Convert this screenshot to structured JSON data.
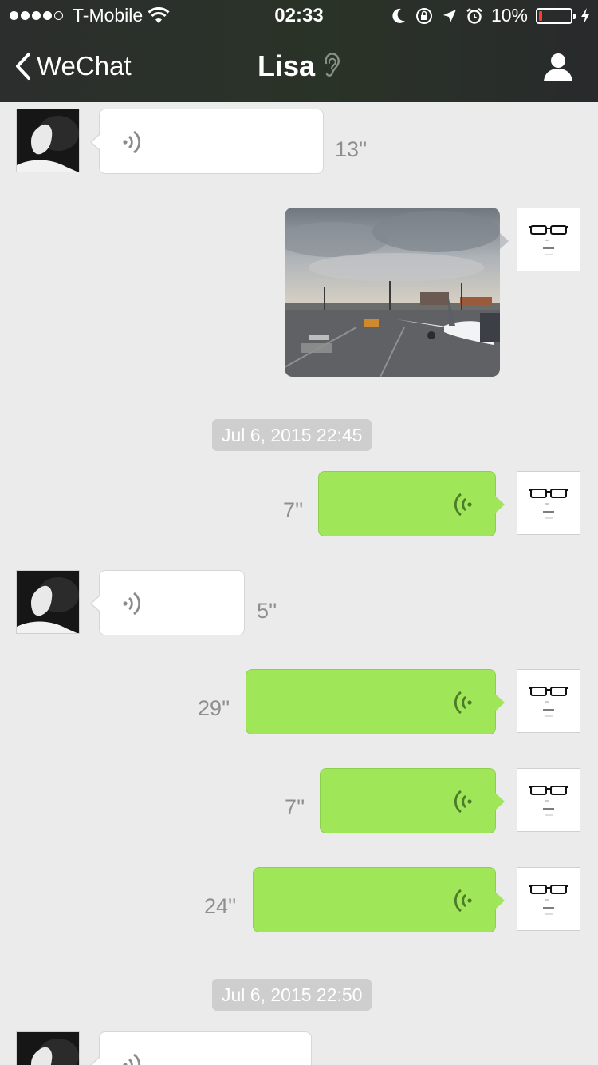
{
  "status": {
    "carrier": "T-Mobile",
    "time": "02:33",
    "battery": "10%",
    "battery_fraction": 0.1,
    "signal_bars": 4
  },
  "nav": {
    "back_label": "WeChat",
    "title": "Lisa"
  },
  "timestamps": [
    "Jul 6, 2015 22:45",
    "Jul 6, 2015 22:50"
  ],
  "messages": [
    {
      "side": "in",
      "type": "voice",
      "duration": "13''"
    },
    {
      "side": "out",
      "type": "image"
    },
    {
      "side": "out",
      "type": "voice",
      "duration": "7''"
    },
    {
      "side": "in",
      "type": "voice",
      "duration": "5''"
    },
    {
      "side": "out",
      "type": "voice",
      "duration": "29''"
    },
    {
      "side": "out",
      "type": "voice",
      "duration": "7''"
    },
    {
      "side": "out",
      "type": "voice",
      "duration": "24''"
    },
    {
      "side": "in",
      "type": "voice",
      "duration": ""
    }
  ],
  "colors": {
    "outgoing_bubble": "#9fe658",
    "incoming_bubble": "#ffffff",
    "background": "#ebebeb",
    "battery_low": "#ff3b30"
  },
  "icons": {
    "back": "chevron-left-icon",
    "listen_mode": "ear-icon",
    "profile": "person-icon",
    "voice": "voice-wave-icon"
  }
}
